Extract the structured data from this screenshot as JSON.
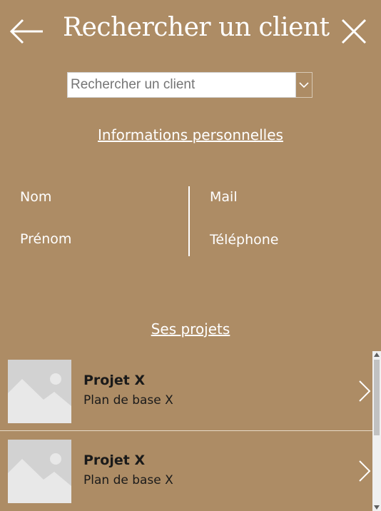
{
  "header": {
    "title": "Rechercher un client",
    "back_icon": "arrow-left-icon",
    "close_icon": "close-icon"
  },
  "search": {
    "placeholder": "Rechercher un client",
    "value": "",
    "chevron_icon": "chevron-down-icon"
  },
  "personal_info": {
    "heading": "Informations personnelles",
    "fields": {
      "nom": "Nom",
      "prenom": "Prénom",
      "mail": "Mail",
      "telephone": "Téléphone"
    }
  },
  "projects": {
    "heading": "Ses projets",
    "items": [
      {
        "title": "Projet X",
        "subtitle": "Plan de base X",
        "image_icon": "image-placeholder-icon"
      },
      {
        "title": "Projet X",
        "subtitle": "Plan de base X",
        "image_icon": "image-placeholder-icon"
      }
    ]
  },
  "colors": {
    "background": "#ad8c65",
    "text": "#ffffff",
    "placeholder_image": "#d2d2d2"
  }
}
